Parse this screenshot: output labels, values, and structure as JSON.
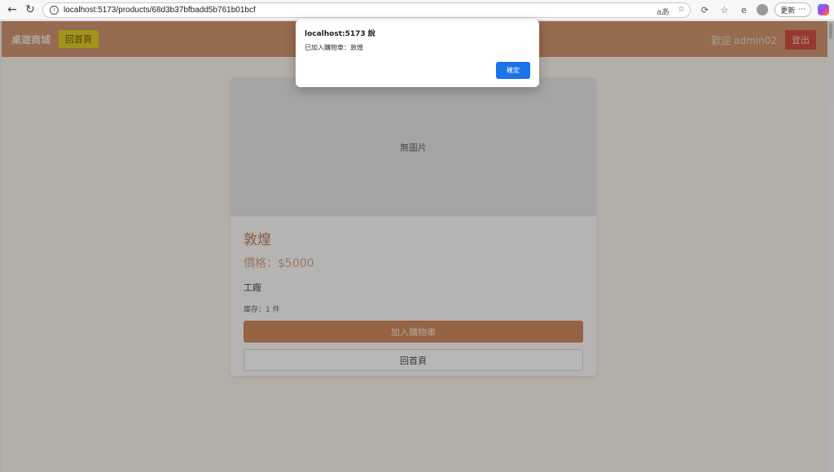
{
  "browser": {
    "url": "localhost:5173/products/68d3b37bfbadd5b761b01bcf",
    "update_label": "更新",
    "icons": [
      "back-icon",
      "refresh-icon",
      "info-icon",
      "read-aloud-icon",
      "favorite-icon",
      "extensions-icon",
      "favorites-bar-icon",
      "edge-icon",
      "profile-icon",
      "more-icon",
      "copilot-icon"
    ]
  },
  "header": {
    "brand": "桌遊商城",
    "home_label": "回首頁",
    "welcome": "歡迎 admin02",
    "logout_label": "登出"
  },
  "product": {
    "image_placeholder": "無圖片",
    "name": "敦煌",
    "price": "價格：$5000",
    "description": "工廠",
    "stock": "庫存：1 件",
    "add_to_cart_label": "加入購物車",
    "back_label": "回首頁"
  },
  "dialog": {
    "title": "localhost:5173 說",
    "message": "已加入購物車：敦煌",
    "ok_label": "確定"
  },
  "colors": {
    "header_bg": "#c6845a",
    "home_btn": "#d8c20a",
    "logout_btn": "#c73a2b",
    "add_cart_btn": "#c8794b",
    "dialog_ok": "#1a73e8"
  }
}
